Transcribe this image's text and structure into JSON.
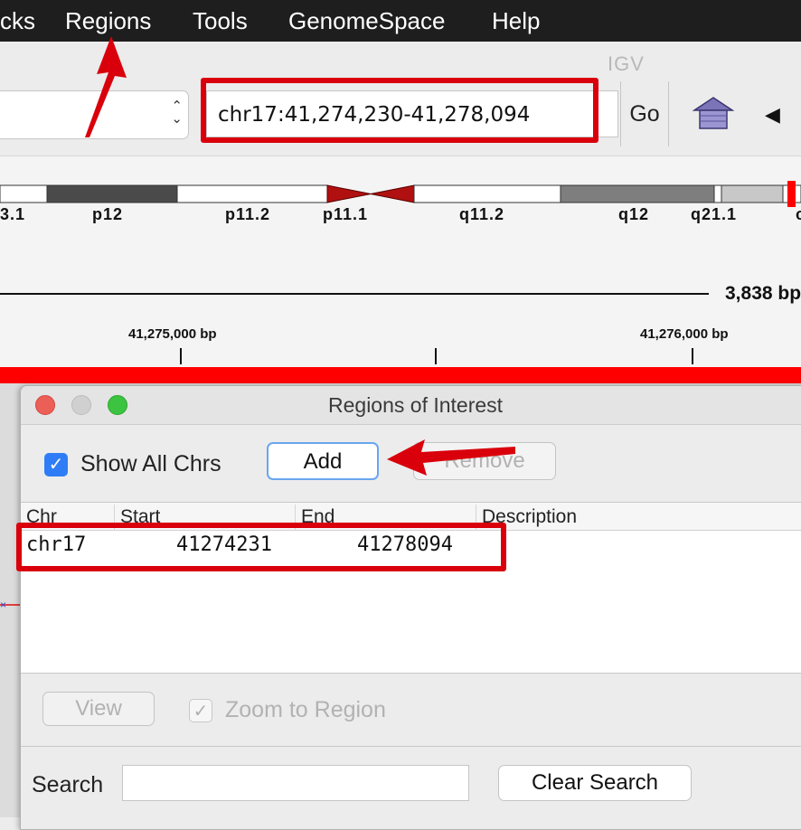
{
  "menubar": {
    "items": [
      {
        "label": "cks"
      },
      {
        "label": "Regions"
      },
      {
        "label": "Tools"
      },
      {
        "label": "GenomeSpace"
      },
      {
        "label": "Help"
      }
    ]
  },
  "toolbar": {
    "app_label": "IGV",
    "locus_value": "chr17:41,274,230-41,278,094",
    "go_label": "Go",
    "home_icon": "home-icon",
    "back_icon": "back-arrow-icon"
  },
  "ideogram": {
    "bands": [
      "3.1",
      "p12",
      "p11.2",
      "p11.1",
      "q11.2",
      "q12",
      "q21.1",
      "c"
    ]
  },
  "ruler": {
    "span_label": "3,838 bp",
    "ticks": [
      "41,275,000 bp",
      "41,276,000 bp"
    ]
  },
  "dialog": {
    "title": "Regions of Interest",
    "show_all_label": "Show All Chrs",
    "show_all_checked": true,
    "add_label": "Add",
    "remove_label": "Remove",
    "table": {
      "columns": [
        "Chr",
        "Start",
        "End",
        "Description"
      ],
      "rows": [
        {
          "chr": "chr17",
          "start": "41274231",
          "end": "41278094",
          "description": ""
        }
      ]
    },
    "view_label": "View",
    "zoom_label": "Zoom to Region",
    "zoom_checked": true,
    "search_label": "Search",
    "search_value": "",
    "clear_search_label": "Clear Search"
  },
  "colors": {
    "highlight": "#d9000b",
    "roi_strip": "#ff0000",
    "accent_blue": "#2f7df6"
  }
}
